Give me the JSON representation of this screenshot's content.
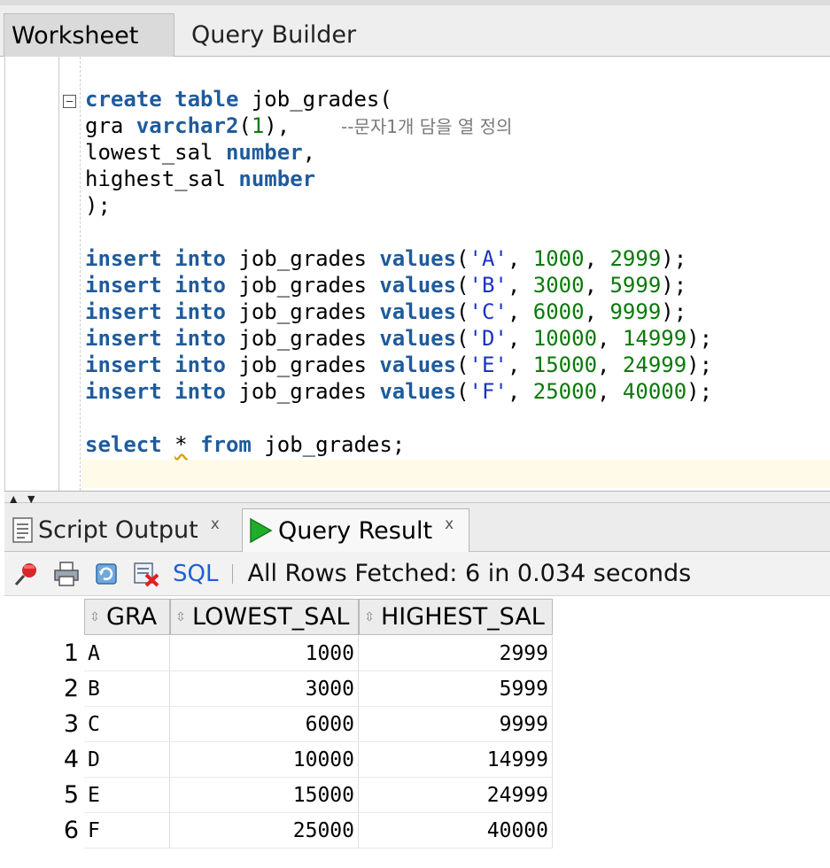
{
  "top_tabs": {
    "worksheet": "Worksheet",
    "query_builder": "Query Builder"
  },
  "editor": {
    "lines": [
      [
        {
          "t": "create",
          "c": "kw"
        },
        {
          "t": " ",
          "c": "tx"
        },
        {
          "t": "table",
          "c": "kw"
        },
        {
          "t": " job_grades(",
          "c": "tx"
        }
      ],
      [
        {
          "t": "gra ",
          "c": "tx"
        },
        {
          "t": "varchar2",
          "c": "kw"
        },
        {
          "t": "(",
          "c": "tx"
        },
        {
          "t": "1",
          "c": "num"
        },
        {
          "t": "),    ",
          "c": "tx"
        },
        {
          "t": "--문자1개 담을 열 정의",
          "c": "cm"
        }
      ],
      [
        {
          "t": "lowest_sal ",
          "c": "tx"
        },
        {
          "t": "number",
          "c": "kw"
        },
        {
          "t": ",",
          "c": "tx"
        }
      ],
      [
        {
          "t": "highest_sal ",
          "c": "tx"
        },
        {
          "t": "number",
          "c": "kw"
        }
      ],
      [
        {
          "t": ");",
          "c": "tx"
        }
      ],
      [],
      [
        {
          "t": "insert",
          "c": "kw"
        },
        {
          "t": " ",
          "c": "tx"
        },
        {
          "t": "into",
          "c": "kw"
        },
        {
          "t": " job_grades ",
          "c": "tx"
        },
        {
          "t": "values",
          "c": "kw"
        },
        {
          "t": "(",
          "c": "tx"
        },
        {
          "t": "'A'",
          "c": "str"
        },
        {
          "t": ", ",
          "c": "tx"
        },
        {
          "t": "1000",
          "c": "num"
        },
        {
          "t": ", ",
          "c": "tx"
        },
        {
          "t": "2999",
          "c": "num"
        },
        {
          "t": ");",
          "c": "tx"
        }
      ],
      [
        {
          "t": "insert",
          "c": "kw"
        },
        {
          "t": " ",
          "c": "tx"
        },
        {
          "t": "into",
          "c": "kw"
        },
        {
          "t": " job_grades ",
          "c": "tx"
        },
        {
          "t": "values",
          "c": "kw"
        },
        {
          "t": "(",
          "c": "tx"
        },
        {
          "t": "'B'",
          "c": "str"
        },
        {
          "t": ", ",
          "c": "tx"
        },
        {
          "t": "3000",
          "c": "num"
        },
        {
          "t": ", ",
          "c": "tx"
        },
        {
          "t": "5999",
          "c": "num"
        },
        {
          "t": ");",
          "c": "tx"
        }
      ],
      [
        {
          "t": "insert",
          "c": "kw"
        },
        {
          "t": " ",
          "c": "tx"
        },
        {
          "t": "into",
          "c": "kw"
        },
        {
          "t": " job_grades ",
          "c": "tx"
        },
        {
          "t": "values",
          "c": "kw"
        },
        {
          "t": "(",
          "c": "tx"
        },
        {
          "t": "'C'",
          "c": "str"
        },
        {
          "t": ", ",
          "c": "tx"
        },
        {
          "t": "6000",
          "c": "num"
        },
        {
          "t": ", ",
          "c": "tx"
        },
        {
          "t": "9999",
          "c": "num"
        },
        {
          "t": ");",
          "c": "tx"
        }
      ],
      [
        {
          "t": "insert",
          "c": "kw"
        },
        {
          "t": " ",
          "c": "tx"
        },
        {
          "t": "into",
          "c": "kw"
        },
        {
          "t": " job_grades ",
          "c": "tx"
        },
        {
          "t": "values",
          "c": "kw"
        },
        {
          "t": "(",
          "c": "tx"
        },
        {
          "t": "'D'",
          "c": "str"
        },
        {
          "t": ", ",
          "c": "tx"
        },
        {
          "t": "10000",
          "c": "num"
        },
        {
          "t": ", ",
          "c": "tx"
        },
        {
          "t": "14999",
          "c": "num"
        },
        {
          "t": ");",
          "c": "tx"
        }
      ],
      [
        {
          "t": "insert",
          "c": "kw"
        },
        {
          "t": " ",
          "c": "tx"
        },
        {
          "t": "into",
          "c": "kw"
        },
        {
          "t": " job_grades ",
          "c": "tx"
        },
        {
          "t": "values",
          "c": "kw"
        },
        {
          "t": "(",
          "c": "tx"
        },
        {
          "t": "'E'",
          "c": "str"
        },
        {
          "t": ", ",
          "c": "tx"
        },
        {
          "t": "15000",
          "c": "num"
        },
        {
          "t": ", ",
          "c": "tx"
        },
        {
          "t": "24999",
          "c": "num"
        },
        {
          "t": ");",
          "c": "tx"
        }
      ],
      [
        {
          "t": "insert",
          "c": "kw"
        },
        {
          "t": " ",
          "c": "tx"
        },
        {
          "t": "into",
          "c": "kw"
        },
        {
          "t": " job_grades ",
          "c": "tx"
        },
        {
          "t": "values",
          "c": "kw"
        },
        {
          "t": "(",
          "c": "tx"
        },
        {
          "t": "'F'",
          "c": "str"
        },
        {
          "t": ", ",
          "c": "tx"
        },
        {
          "t": "25000",
          "c": "num"
        },
        {
          "t": ", ",
          "c": "tx"
        },
        {
          "t": "40000",
          "c": "num"
        },
        {
          "t": ");",
          "c": "tx"
        }
      ],
      [],
      [
        {
          "t": "select",
          "c": "kw"
        },
        {
          "t": " ",
          "c": "tx"
        },
        {
          "t": "*",
          "c": "tx squiggle"
        },
        {
          "t": " ",
          "c": "tx"
        },
        {
          "t": "from",
          "c": "kw"
        },
        {
          "t": " job_grades;",
          "c": "tx"
        }
      ]
    ]
  },
  "bottom_tabs": {
    "script_output": "Script Output",
    "query_result": "Query Result",
    "close_glyph": "x"
  },
  "toolbar": {
    "sql_label": "SQL",
    "status": "All Rows Fetched: 6 in 0.034 seconds"
  },
  "results": {
    "columns": [
      "GRA",
      "LOWEST_SAL",
      "HIGHEST_SAL"
    ],
    "rows": [
      {
        "n": "1",
        "gra": "A",
        "low": "1000",
        "high": "2999"
      },
      {
        "n": "2",
        "gra": "B",
        "low": "3000",
        "high": "5999"
      },
      {
        "n": "3",
        "gra": "C",
        "low": "6000",
        "high": "9999"
      },
      {
        "n": "4",
        "gra": "D",
        "low": "10000",
        "high": "14999"
      },
      {
        "n": "5",
        "gra": "E",
        "low": "15000",
        "high": "24999"
      },
      {
        "n": "6",
        "gra": "F",
        "low": "25000",
        "high": "40000"
      }
    ]
  },
  "colors": {
    "keyword": "#1f5b9c",
    "string": "#1a33c2",
    "number": "#0a7a0a",
    "comment": "#7a7a7a",
    "sql_link": "#1f5fd1",
    "run_icon": "#1fae2a"
  }
}
